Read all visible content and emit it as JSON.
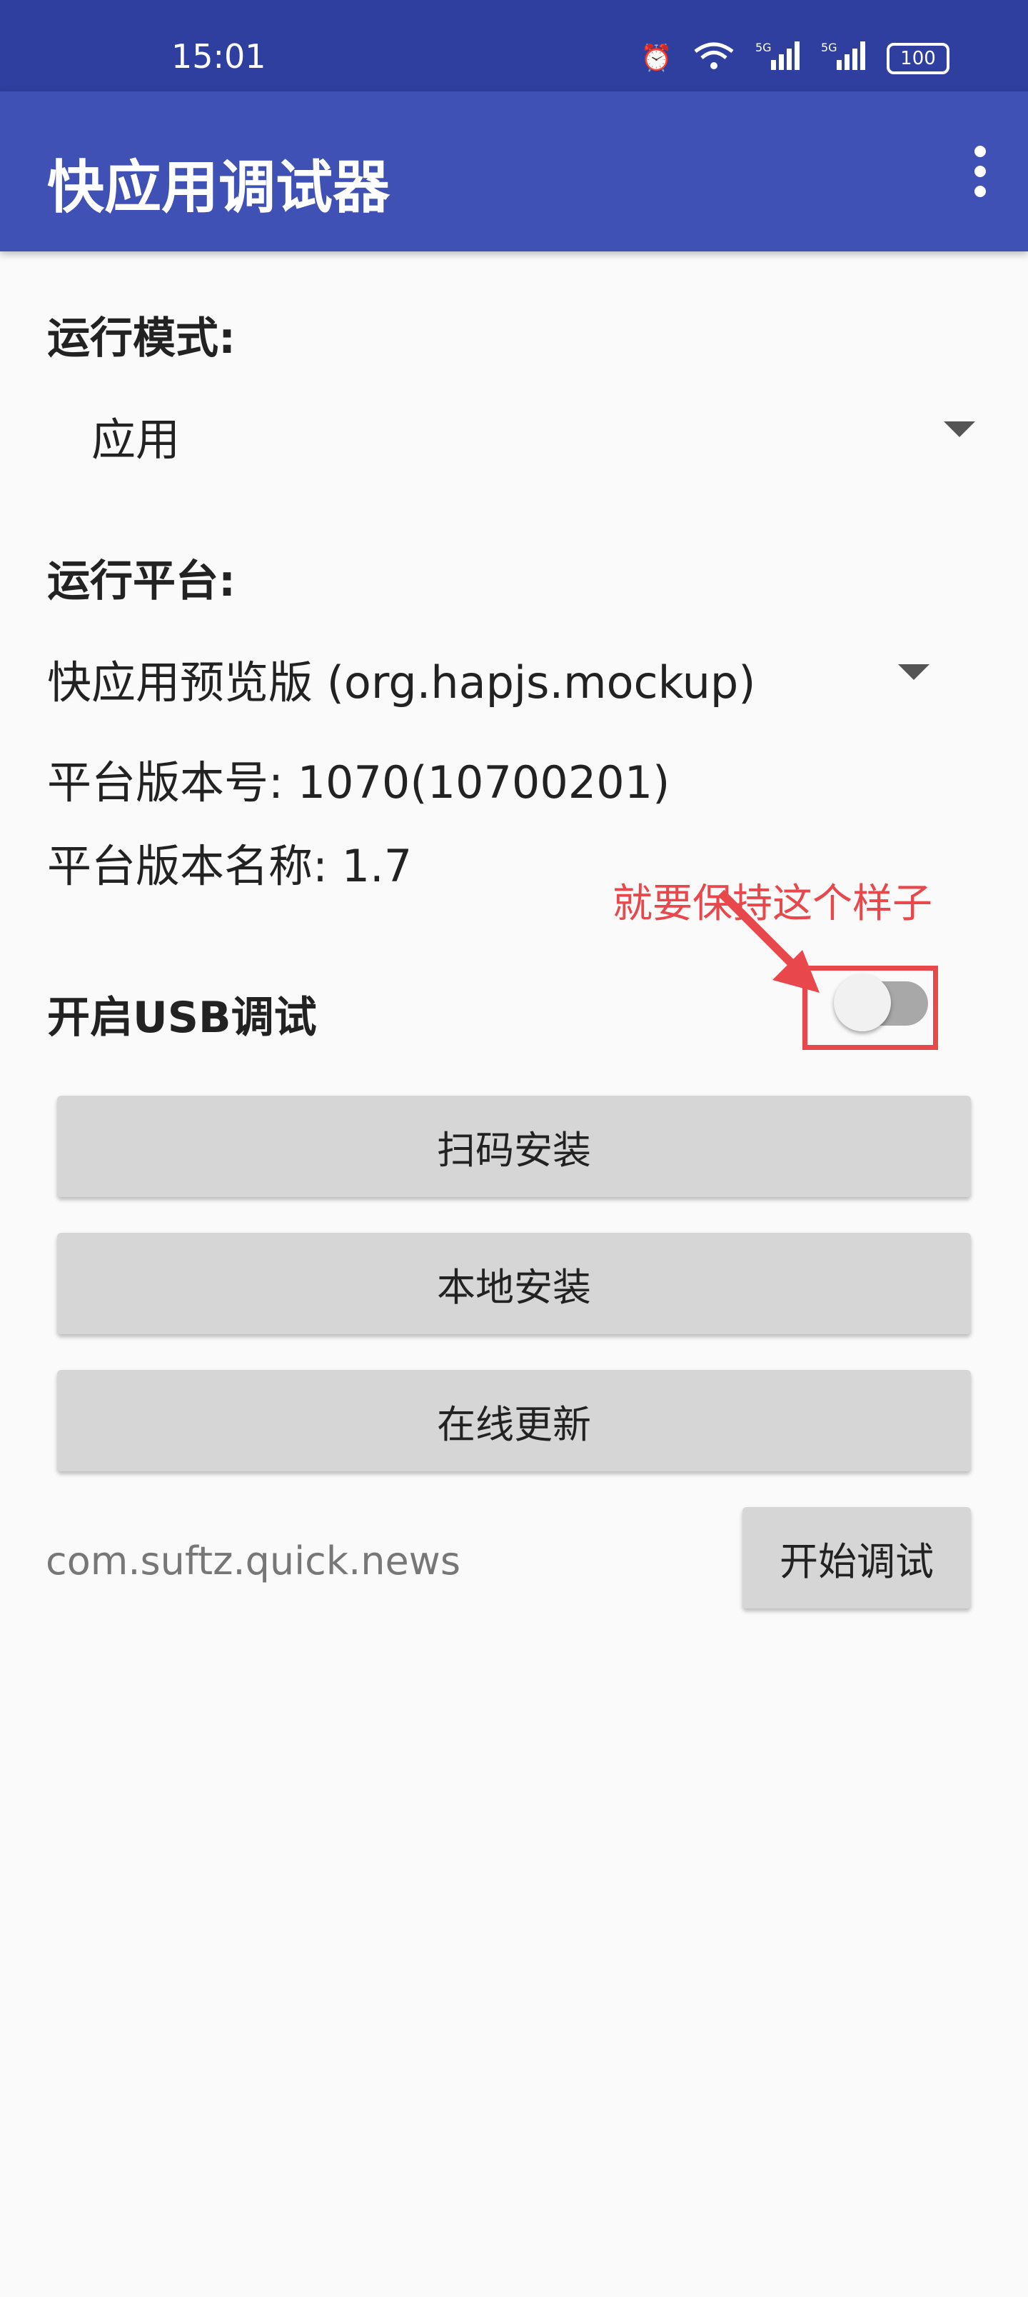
{
  "status_bar": {
    "time": "15:01",
    "icons": [
      "alarm-icon",
      "wifi-icon",
      "signal-5g-icon",
      "signal-5g-icon",
      "battery-icon"
    ],
    "signal_label": "5G",
    "battery": "100"
  },
  "app_bar": {
    "title": "快应用调试器",
    "overflow_icon": "more-vert-icon"
  },
  "run_mode": {
    "label": "运行模式:",
    "selected": "应用"
  },
  "platform": {
    "label": "运行平台:",
    "selected": "快应用预览版 (org.hapjs.mockup)",
    "version_code": "平台版本号: 1070(10700201)",
    "version_name": "平台版本名称: 1.7"
  },
  "annotation": {
    "text": "就要保持这个样子",
    "color": "#e8474b"
  },
  "usb_debug": {
    "label": "开启USB调试",
    "enabled": false
  },
  "buttons": {
    "scan_install": "扫码安装",
    "local_install": "本地安装",
    "online_update": "在线更新",
    "start_debug": "开始调试"
  },
  "package": {
    "value": "com.suftz.quick.news"
  },
  "colors": {
    "status_bar": "#2f3f9f",
    "app_bar": "#3f51b5",
    "button": "#d6d6d6"
  }
}
